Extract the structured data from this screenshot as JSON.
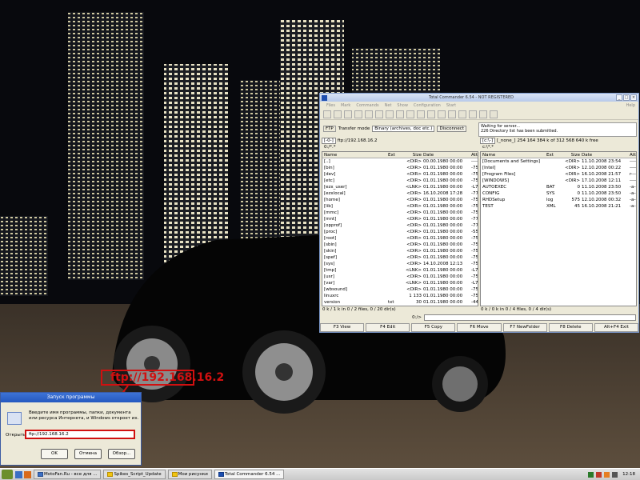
{
  "window": {
    "title": "Total Commander 6.54 - NOT REGISTERED",
    "menu": [
      "Files",
      "Mark",
      "Commands",
      "Net",
      "Show",
      "Configuration",
      "Start"
    ],
    "help": "Help"
  },
  "ftp": {
    "ftp_label": "FTP",
    "transfer_mode_label": "Transfer mode",
    "transfer_mode_value": "Binary (archives, doc etc.)",
    "disconnect_button": "Disconnect",
    "messages": [
      "Waiting for server...",
      "226 Directory list has been submitted."
    ]
  },
  "left": {
    "drive": "[-0-]",
    "path": "ftp://192.168.16.2",
    "current": "0:/*.*",
    "headers": [
      "Name",
      "Ext",
      "Size",
      "Date",
      "Attr"
    ],
    "rows": [
      [
        "[..]",
        "",
        "<DIR>",
        "00.00.1980 00:00",
        "----"
      ],
      [
        "[bin]",
        "",
        "<DIR>",
        "01.01.1980 00:00",
        "-755"
      ],
      [
        "[dev]",
        "",
        "<DIR>",
        "01.01.1980 00:00",
        "-755"
      ],
      [
        "[etc]",
        "",
        "<DIR>",
        "01.01.1980 00:00",
        "-755"
      ],
      [
        "[ezx_user]",
        "",
        "<LNK>",
        "01.01.1980 00:00",
        "-L77"
      ],
      [
        "[ezxlocal]",
        "",
        "<DIR>",
        "16.10.2008 17:28",
        "-777"
      ],
      [
        "[home]",
        "",
        "<DIR>",
        "01.01.1980 00:00",
        "-755"
      ],
      [
        "[lib]",
        "",
        "<DIR>",
        "01.01.1980 00:00",
        "-755"
      ],
      [
        "[mmc]",
        "",
        "<DIR>",
        "01.01.1980 00:00",
        "-755"
      ],
      [
        "[mnt]",
        "",
        "<DIR>",
        "01.01.1980 00:00",
        "-777"
      ],
      [
        "[opprof]",
        "",
        "<DIR>",
        "01.01.1980 00:00",
        "-777"
      ],
      [
        "[proc]",
        "",
        "<DIR>",
        "01.01.1980 00:00",
        "-555"
      ],
      [
        "[root]",
        "",
        "<DIR>",
        "01.01.1980 00:00",
        "-755"
      ],
      [
        "[sbin]",
        "",
        "<DIR>",
        "01.01.1980 00:00",
        "-755"
      ],
      [
        "[skin]",
        "",
        "<DIR>",
        "01.01.1980 00:00",
        "-755"
      ],
      [
        "[spef]",
        "",
        "<DIR>",
        "01.01.1980 00:00",
        "-755"
      ],
      [
        "[sys]",
        "",
        "<DIR>",
        "14.10.2008 12:13",
        "-755"
      ],
      [
        "[tmp]",
        "",
        "<LNK>",
        "01.01.1980 00:00",
        "-L77"
      ],
      [
        "[usr]",
        "",
        "<DIR>",
        "01.01.1980 00:00",
        "-755"
      ],
      [
        "[var]",
        "",
        "<LNK>",
        "01.01.1980 00:00",
        "-L77"
      ],
      [
        "[wbsound]",
        "",
        "<DIR>",
        "01.01.1980 00:00",
        "-755"
      ],
      [
        "linuxrc",
        "",
        "1 133",
        "01.01.1980 00:00",
        "-755"
      ],
      [
        "version",
        "txt",
        "30",
        "01.01.1980 00:00",
        "-444"
      ]
    ],
    "status": "0 k / 1 k in 0 / 2 files, 0 / 20 dir(s)"
  },
  "right": {
    "drive": "[c:\\-]",
    "volume": "[_none_]",
    "free": "254 164 384 k of 312 568 640 k free",
    "current": "c:\\*.*",
    "headers": [
      "Name",
      "Ext",
      "Size",
      "Date",
      "Attr"
    ],
    "rows": [
      [
        "[Documents and Settings]",
        "",
        "<DIR>",
        "11.10.2008 23:54",
        "----"
      ],
      [
        "[Intel]",
        "",
        "<DIR>",
        "12.10.2008 00:22",
        "----"
      ],
      [
        "[Program Files]",
        "",
        "<DIR>",
        "16.10.2008 21:57",
        "r---"
      ],
      [
        "[WINDOWS]",
        "",
        "<DIR>",
        "17.10.2008 12:11",
        "----"
      ],
      [
        "AUTOEXEC",
        "BAT",
        "0",
        "11.10.2008 23:50",
        "-a--"
      ],
      [
        "CONFIG",
        "SYS",
        "0",
        "11.10.2008 23:50",
        "-a--"
      ],
      [
        "RHDSetup",
        "log",
        "575",
        "12.10.2008 00:32",
        "-a--"
      ],
      [
        "TEST",
        "XML",
        "45",
        "16.10.2008 21:21",
        "-a--"
      ]
    ],
    "status": "0 k / 0 k in 0 / 4 files, 0 / 4 dir(s)"
  },
  "cmd_path": "0:/>",
  "fkeys": [
    "F3 View",
    "F4 Edit",
    "F5 Copy",
    "F6 Move",
    "F7 NewFolder",
    "F8 Delete",
    "Alt+F4 Exit"
  ],
  "callout": "ftp://192.168.16.2",
  "run_dialog": {
    "title": "Запуск программы",
    "text": "Введите имя программы, папки, документа или ресурса Интернета, и Windows откроет их.",
    "open_label": "Открыть:",
    "open_value": "ftp://192.168.16.2",
    "ok": "OK",
    "cancel": "Отмена",
    "browse": "Обзор..."
  },
  "taskbar": {
    "tasks": [
      "MotoFan.Ru - все для ...",
      "Spikes_Script_Update",
      "Мои рисунки",
      "Total Commander 6.54 ..."
    ],
    "clock": "12:18"
  }
}
